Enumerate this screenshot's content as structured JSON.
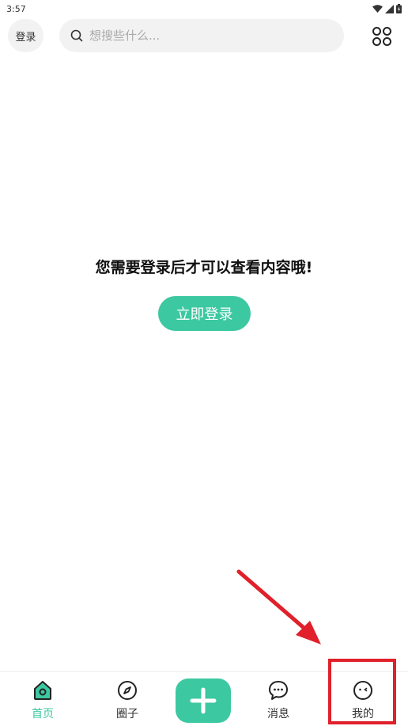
{
  "status_bar": {
    "time": "3:57"
  },
  "header": {
    "login_label": "登录",
    "search_placeholder": "想搜些什么..."
  },
  "main": {
    "prompt": "您需要登录后才可以查看内容哦!",
    "login_button": "立即登录"
  },
  "bottom_nav": {
    "items": [
      {
        "label": "首页",
        "icon": "home-icon",
        "active": true
      },
      {
        "label": "圈子",
        "icon": "compass-icon",
        "active": false
      },
      {
        "label": "",
        "icon": "plus-icon",
        "active": false
      },
      {
        "label": "消息",
        "icon": "chat-icon",
        "active": false
      },
      {
        "label": "我的",
        "icon": "profile-icon",
        "active": false
      }
    ]
  },
  "colors": {
    "accent": "#3cc8a1",
    "annotation": "#e0202a"
  }
}
